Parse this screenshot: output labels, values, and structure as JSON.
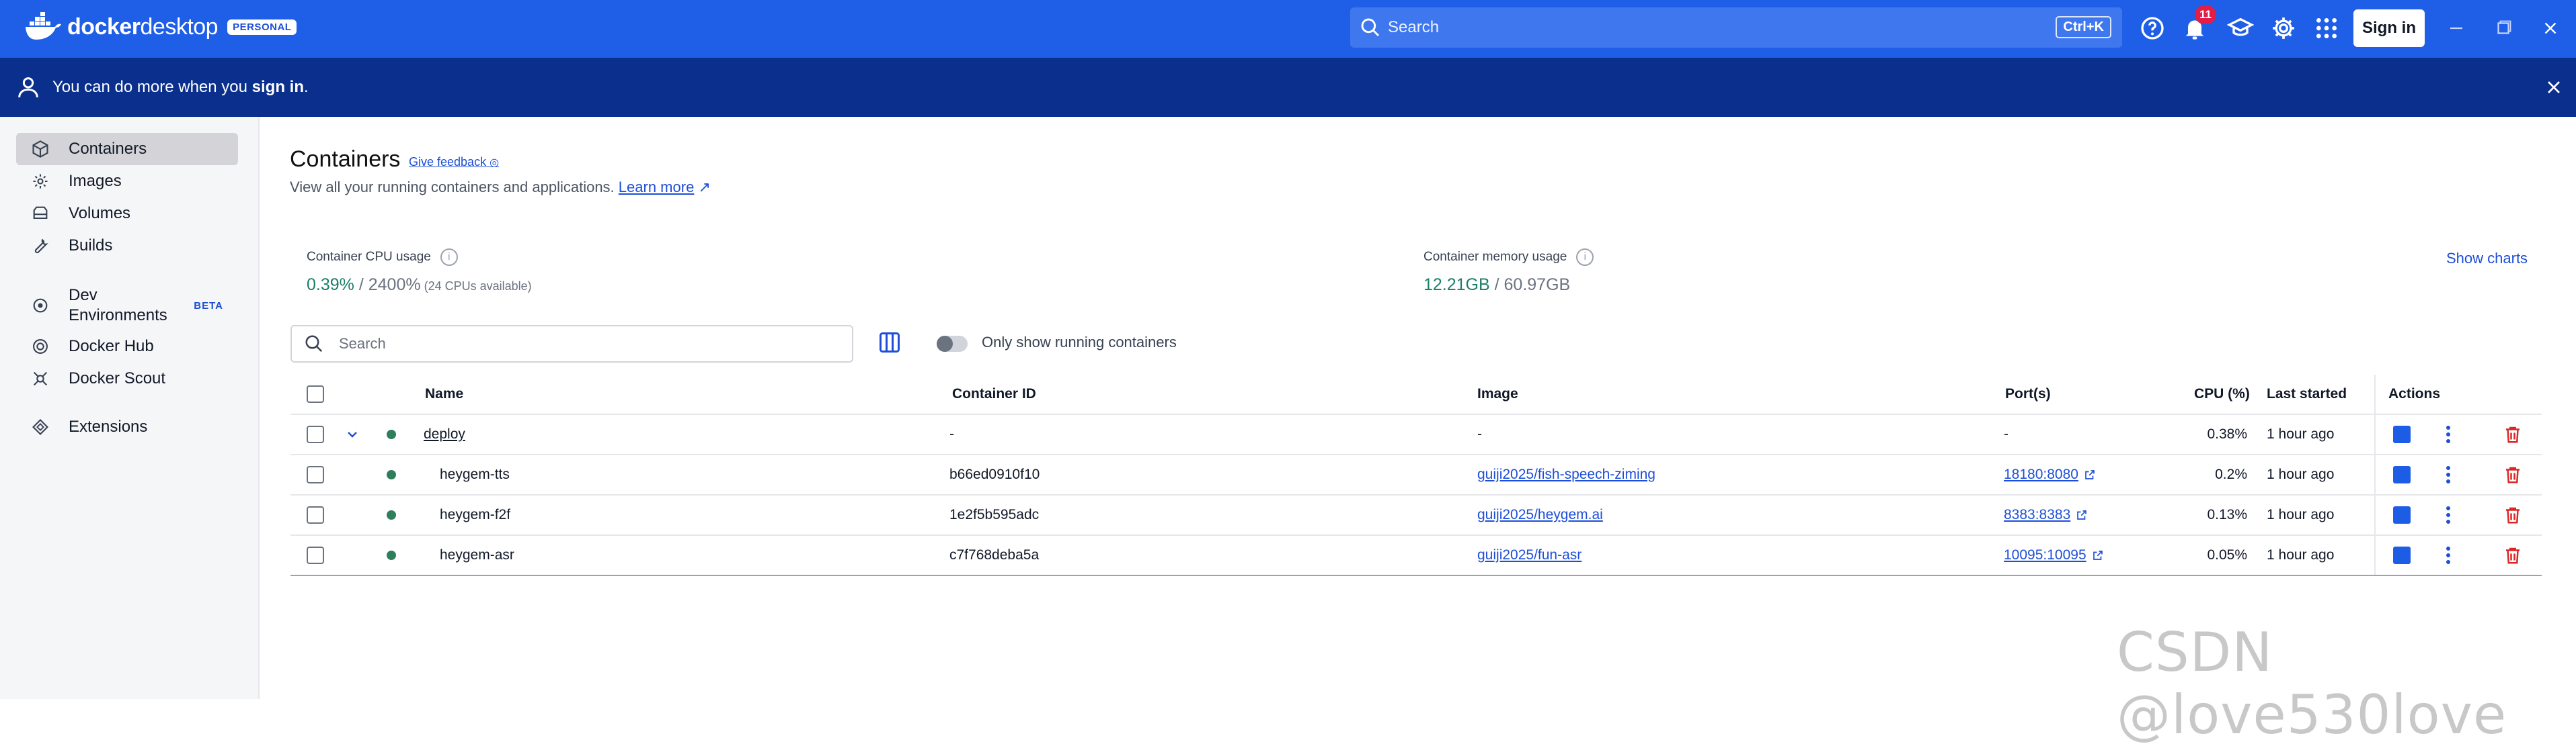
{
  "app": {
    "logo_bold": "docker",
    "logo_light": "desktop",
    "badge": "PERSONAL"
  },
  "titlebar": {
    "search_label": "Search",
    "search_shortcut": "Ctrl+K",
    "notification_count": "11",
    "signin_label": "Sign in"
  },
  "banner": {
    "text_before": "You can do more when you ",
    "link_text": "sign in",
    "text_after": "."
  },
  "sidebar": {
    "items": [
      {
        "label": "Containers",
        "icon": "containers-icon"
      },
      {
        "label": "Images",
        "icon": "images-icon"
      },
      {
        "label": "Volumes",
        "icon": "volumes-icon"
      },
      {
        "label": "Builds",
        "icon": "builds-icon"
      },
      {
        "label_line1": "Dev",
        "label_line2": "Environments",
        "badge": "BETA",
        "icon": "dev-environments-icon"
      },
      {
        "label": "Docker Hub",
        "icon": "docker-hub-icon"
      },
      {
        "label": "Docker Scout",
        "icon": "docker-scout-icon"
      },
      {
        "label": "Extensions",
        "icon": "extensions-icon"
      }
    ]
  },
  "main": {
    "title": "Containers",
    "feedback": "Give feedback",
    "subtitle": "View all your running containers and applications.",
    "learn_more": "Learn more",
    "cpu": {
      "label": "Container CPU usage",
      "used": "0.39%",
      "total": " / 2400%",
      "note": " (24 CPUs available)"
    },
    "memory": {
      "label": "Container memory usage",
      "used": "12.21GB",
      "total": " / 60.97GB"
    },
    "show_charts": "Show charts",
    "search_placeholder": "Search",
    "toggle_label": "Only show running containers"
  },
  "table": {
    "columns": [
      "Name",
      "Container ID",
      "Image",
      "Port(s)",
      "CPU (%)",
      "Last started",
      "Actions"
    ],
    "rows": [
      {
        "name": "deploy",
        "id": "-",
        "image": "-",
        "ports": "-",
        "cpu": "0.38%",
        "started": "1 hour ago"
      },
      {
        "name": "heygem-tts",
        "id": "b66ed0910f10",
        "image": "guiji2025/fish-speech-ziming",
        "ports": "18180:8080",
        "cpu": "0.2%",
        "started": "1 hour ago"
      },
      {
        "name": "heygem-f2f",
        "id": "1e2f5b595adc",
        "image": "guiji2025/heygem.ai",
        "ports": "8383:8383",
        "cpu": "0.13%",
        "started": "1 hour ago"
      },
      {
        "name": "heygem-asr",
        "id": "c7f768deba5a",
        "image": "guiji2025/fun-asr",
        "ports": "10095:10095",
        "cpu": "0.05%",
        "started": "1 hour ago"
      }
    ]
  },
  "watermark": "CSDN @love530love",
  "colors": {
    "titlebar": "#1f5ee6",
    "banner": "#0b2f8c",
    "accent": "#1d4ed8",
    "running": "#2e7d5b",
    "danger": "#dc2626"
  }
}
